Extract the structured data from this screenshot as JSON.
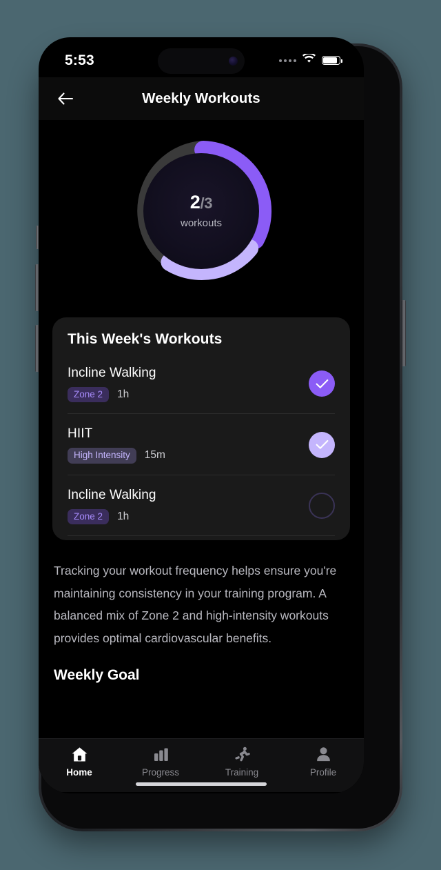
{
  "theme": {
    "outer_background": "#4b6770",
    "screen_background": "#000000",
    "card_background": "#1a1a1a",
    "accent_purple": "#8b5cf6",
    "accent_light_purple": "#c4b5fd",
    "track_gray": "#3a3a3a",
    "badge_zone_bg": "#3a2d5c",
    "badge_zone_text": "#a78bfa",
    "badge_high_bg": "#413d55",
    "badge_high_text": "#c4b5fd",
    "incomplete_ring": "#3a3356"
  },
  "status_bar": {
    "time": "5:53",
    "signal_icon": "signal-dots-icon",
    "wifi_icon": "wifi-icon",
    "battery_icon": "battery-icon"
  },
  "header": {
    "back_icon": "arrow-left-icon",
    "title": "Weekly Workouts"
  },
  "progress_ring": {
    "completed": "2",
    "denominator": "/3",
    "label": "workouts",
    "segments": [
      {
        "name": "incomplete",
        "color": "#3a3a3a",
        "start_deg": -90,
        "end_deg": -235
      },
      {
        "name": "completed-primary",
        "color": "#8b5cf6",
        "start_deg": -88,
        "end_deg": 28
      },
      {
        "name": "completed-secondary",
        "color": "#c4b5fd",
        "start_deg": 38,
        "end_deg": 148
      }
    ]
  },
  "workouts_card": {
    "title": "This Week's Workouts",
    "items": [
      {
        "name": "Incline Walking",
        "badge": "Zone 2",
        "badge_type": "zone2",
        "duration": "1h",
        "status": "done",
        "check_icon": "check-icon"
      },
      {
        "name": "HIIT",
        "badge": "High Intensity",
        "badge_type": "high",
        "duration": "15m",
        "status": "done-light",
        "check_icon": "check-icon"
      },
      {
        "name": "Incline Walking",
        "badge": "Zone 2",
        "badge_type": "zone2",
        "duration": "1h",
        "status": "todo",
        "check_icon": "empty-circle-icon"
      }
    ]
  },
  "description": "Tracking your workout frequency helps ensure you're maintaining consistency in your training program. A balanced mix of Zone 2 and high-intensity workouts provides optimal cardiovascular benefits.",
  "next_section_partial": "Weekly Goal",
  "tab_bar": {
    "tabs": [
      {
        "label": "Home",
        "icon": "home-icon",
        "active": true
      },
      {
        "label": "Progress",
        "icon": "bar-chart-icon",
        "active": false
      },
      {
        "label": "Training",
        "icon": "running-person-icon",
        "active": false
      },
      {
        "label": "Profile",
        "icon": "person-icon",
        "active": false
      }
    ]
  }
}
